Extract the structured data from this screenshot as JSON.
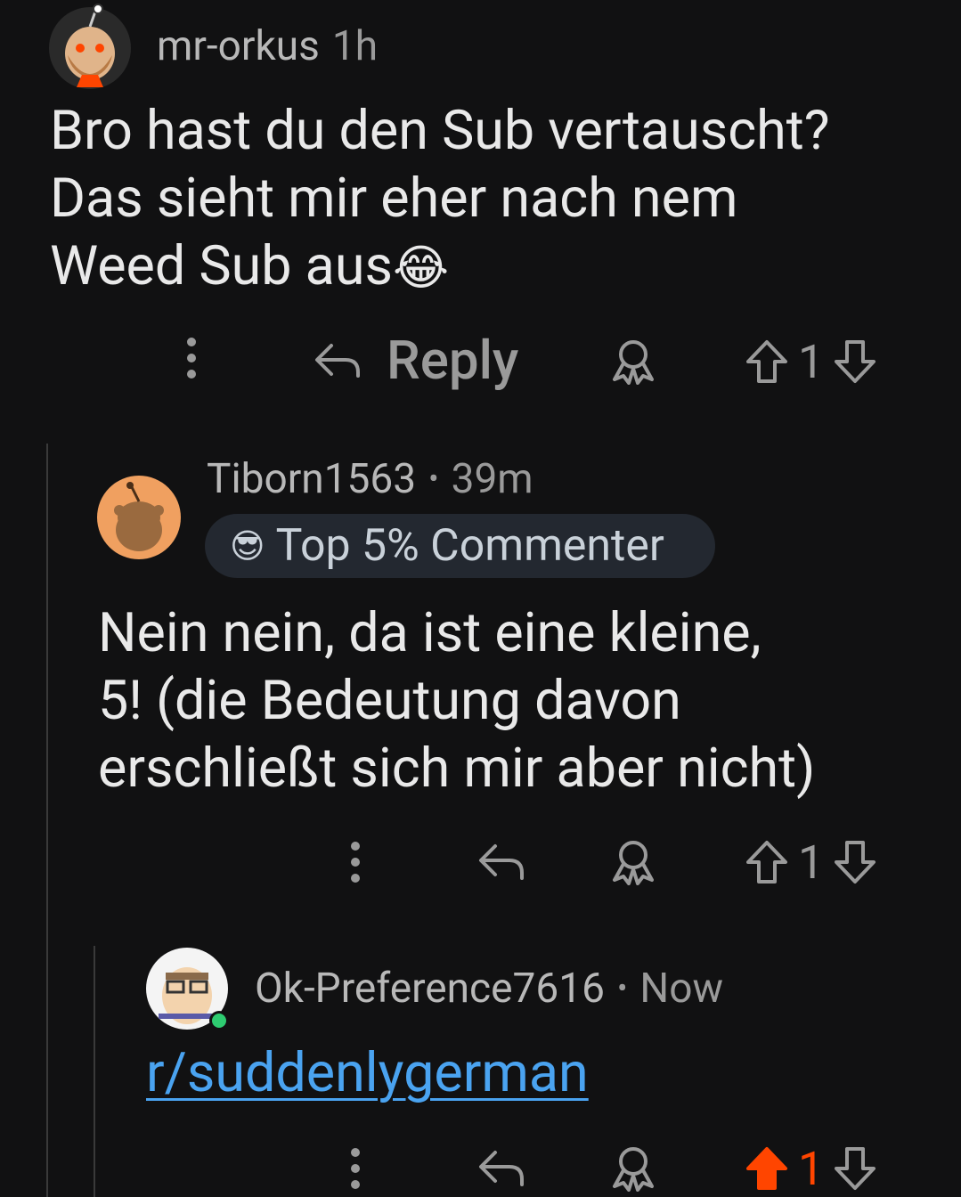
{
  "comments": [
    {
      "username": "mr-orkus",
      "time": "1h",
      "body_lines": [
        "Bro hast du den Sub vertauscht?",
        "Das sieht mir eher nach nem",
        "Weed Sub aus"
      ],
      "emoji": "😂",
      "reply_label": "Reply",
      "votes": "1",
      "vote_state": "none"
    },
    {
      "username": "Tiborn1563",
      "separator": "•",
      "time": "39m",
      "flair": "Top 5% Commenter",
      "flair_emoji": "😎",
      "body_lines": [
        "Nein nein, da ist eine kleine,",
        "5! (die Bedeutung davon",
        "erschließt sich mir aber nicht)"
      ],
      "votes": "1",
      "vote_state": "none"
    },
    {
      "username": "Ok-Preference7616",
      "separator": "•",
      "time": "Now",
      "link": "r/suddenlygerman",
      "votes": "1",
      "vote_state": "upvoted"
    }
  ],
  "colors": {
    "background": "#111112",
    "upvote_active": "#ff4500",
    "link": "#4aa3f0",
    "online": "#2ecc71"
  },
  "icons": [
    "more-icon",
    "reply-icon",
    "award-icon",
    "upvote-icon",
    "downvote-icon"
  ]
}
